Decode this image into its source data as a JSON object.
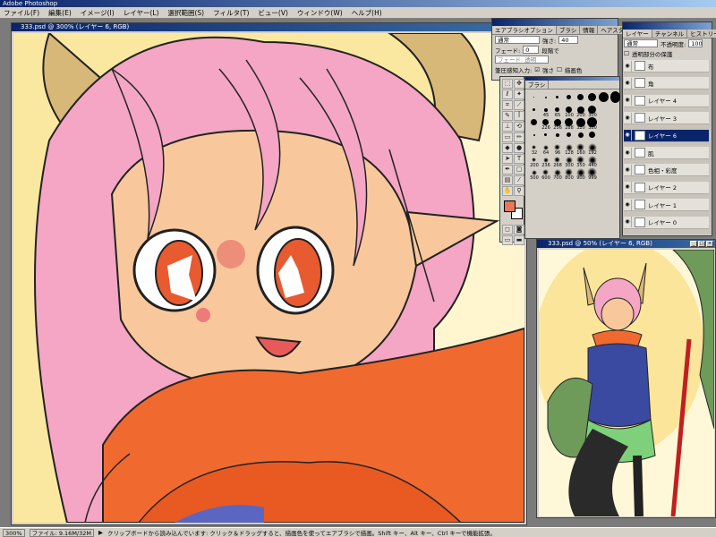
{
  "app": {
    "title": "Adobe Photoshop"
  },
  "menu": [
    "ファイル(F)",
    "編集(E)",
    "イメージ(I)",
    "レイヤー(L)",
    "選択範囲(S)",
    "フィルタ(T)",
    "ビュー(V)",
    "ウィンドウ(W)",
    "ヘルプ(H)"
  ],
  "document": {
    "title": "333.psd @ 300% (レイヤー 6, RGB)"
  },
  "brush_options": {
    "tabs": [
      "エアブラシオプション",
      "ブラシ",
      "情報",
      "ヘアスタイル"
    ],
    "mode": "通常",
    "pressure_label": "強さ:",
    "pressure": "40",
    "fade_label": "フェード:",
    "fade_value": "0",
    "fade_unit": "段階で",
    "fade_to": "フェード: 透明",
    "stylus_label": "筆圧感知入力:",
    "stylus_opt1": "強さ",
    "stylus_opt2": "描画色"
  },
  "brushes_panel": {
    "tab": "ブラシ",
    "row1_labels": [],
    "row2_labels": [
      "45",
      "65",
      "100",
      "200",
      "300"
    ],
    "row3_labels": [
      "226",
      "256",
      "288",
      "320",
      "380"
    ],
    "row4_labels": [
      "32",
      "64",
      "96",
      "128",
      "160",
      "192"
    ],
    "row5_labels": [
      "200",
      "236",
      "268",
      "300",
      "350",
      "440"
    ],
    "row6_labels": [
      "500",
      "600",
      "700",
      "800",
      "900",
      "999"
    ]
  },
  "layers_panel": {
    "tabs": [
      "レイヤー",
      "チャンネル",
      "ヒストリー"
    ],
    "mode": "通常",
    "opacity_label": "不透明度:",
    "opacity": "100",
    "preserve": "透明部分の保護",
    "layers": [
      "布",
      "角",
      "レイヤー 4",
      "レイヤー 3",
      "レイヤー 6",
      "肌",
      "色相・彩度",
      "レイヤー 2",
      "レイヤー 1",
      "レイヤー 0"
    ],
    "selected_index": 4
  },
  "small_document": {
    "title": "333.psd @ 50% (レイヤー 6, RGB)"
  },
  "status": {
    "zoom": "300%",
    "file": "ファイル: 9.16M/32M",
    "hint": "クリップボードから読み込んでいます: クリック＆ドラッグすると、描画色を使ってエアブラシで描画。Shift キー、Alt キー、Ctrl キーで機能拡張。"
  },
  "colors": {
    "foreground": "#e8765a",
    "background": "#ffffff",
    "accent": "#0a246a"
  }
}
